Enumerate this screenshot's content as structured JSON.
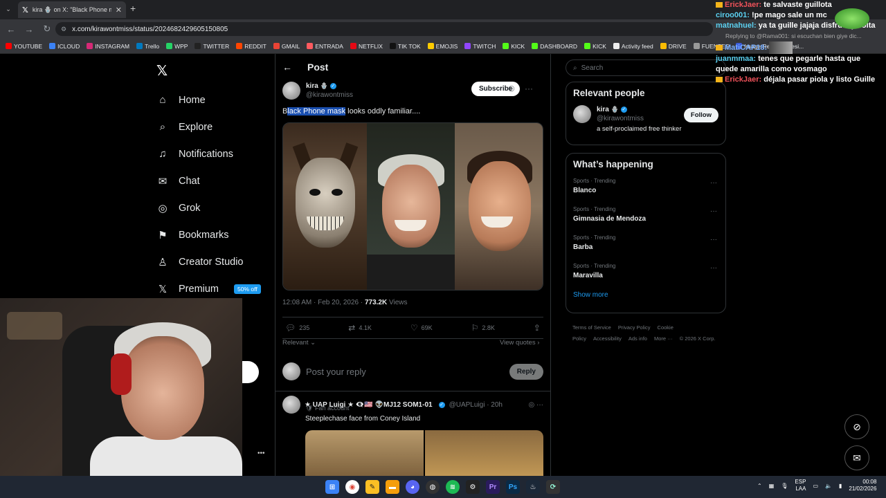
{
  "browser": {
    "tab_title": "kira 🪬 on X: \"Black Phone ma...",
    "url": "x.com/kirawontmiss/status/2024682429605150805",
    "bookmarks": [
      {
        "label": "YOUTUBE",
        "color": "#ff0000"
      },
      {
        "label": "ICLOUD",
        "color": "#3b82f6"
      },
      {
        "label": "INSTAGRAM",
        "color": "#d62976"
      },
      {
        "label": "Trello",
        "color": "#0079bf"
      },
      {
        "label": "WPP",
        "color": "#25d366"
      },
      {
        "label": "TWITTER",
        "color": "#222222"
      },
      {
        "label": "REDDIT",
        "color": "#ff4500"
      },
      {
        "label": "GMAIL",
        "color": "#ea4335"
      },
      {
        "label": "ENTRADA",
        "color": "#ff5a5f"
      },
      {
        "label": "NETFLIX",
        "color": "#e50914"
      },
      {
        "label": "TIK TOK",
        "color": "#111111"
      },
      {
        "label": "EMOJIS",
        "color": "#ffcc00"
      },
      {
        "label": "TWITCH",
        "color": "#9146ff"
      },
      {
        "label": "KICK",
        "color": "#53fc18"
      },
      {
        "label": "DASHBOARD",
        "color": "#53fc18"
      },
      {
        "label": "KICK",
        "color": "#53fc18"
      },
      {
        "label": "Activity feed",
        "color": "#eeeeee"
      },
      {
        "label": "DRIVE",
        "color": "#fbbc04"
      },
      {
        "label": "FUENTES",
        "color": "#999999"
      },
      {
        "label": "Image Resizer | Resi...",
        "color": "#3b5bdb"
      }
    ]
  },
  "nav": {
    "items": [
      {
        "label": "Home",
        "icon": "⌂"
      },
      {
        "label": "Explore",
        "icon": "⌕"
      },
      {
        "label": "Notifications",
        "icon": "♫"
      },
      {
        "label": "Chat",
        "icon": "✉"
      },
      {
        "label": "Grok",
        "icon": "◎"
      },
      {
        "label": "Bookmarks",
        "icon": "⚑"
      },
      {
        "label": "Creator Studio",
        "icon": "♙"
      },
      {
        "label": "Premium",
        "icon": "𝕏"
      }
    ],
    "premium_badge": "50% off"
  },
  "post": {
    "header": "Post",
    "author_name": "kira",
    "author_handle": "@kirawontmiss",
    "subscribe_label": "Subscribe",
    "text_highlight": "lack Phone mask",
    "text_pre": "B",
    "text_post": " looks oddly familiar....",
    "time": "12:08 AM · Feb 20, 2026 · ",
    "views_count": "773.2K",
    "views_label": " Views",
    "replies": "235",
    "reposts": "4.1K",
    "likes": "69K",
    "bookmarks": "2.8K",
    "relevant": "Relevant",
    "view_quotes": "View quotes",
    "reply_placeholder": "Post your reply",
    "reply_button": "Reply"
  },
  "reply_post": {
    "name": "★ UAP Luigi ★ 👁‍🗨🇺🇸 👽MJ12 SOM1-01",
    "handle": "@UAPLuigi · 20h",
    "badge": "Fan account",
    "text": "Steeplechase face from Coney Island"
  },
  "right": {
    "search_placeholder": "Search",
    "relevant_people_title": "Relevant people",
    "person_name": "kira",
    "person_handle": "@kirawontmiss",
    "person_bio": "a self-proclaimed free thinker",
    "follow_label": "Follow",
    "happening_title": "What’s happening",
    "trends": [
      {
        "category": "Sports · Trending",
        "topic": "Blanco"
      },
      {
        "category": "Sports · Trending",
        "topic": "Gimnasia de Mendoza"
      },
      {
        "category": "Sports · Trending",
        "topic": "Barba"
      },
      {
        "category": "Sports · Trending",
        "topic": "Maravilla"
      }
    ],
    "show_more": "Show more",
    "footer": [
      "Terms of Service",
      "Privacy Policy",
      "Cookie Policy",
      "Accessibility",
      "Ads info",
      "More ···",
      "© 2026 X Corp."
    ]
  },
  "chat": [
    {
      "user": "ErickJaer:",
      "msg": "te salvaste guillota",
      "color": "red",
      "crown": true
    },
    {
      "user": "ciroo001:",
      "msg": "!pe mago sale un mc",
      "color": "cyan",
      "crown": false
    },
    {
      "user": "matnahuel:",
      "msg": "ya ta guille jajaja disfruta y solta",
      "color": "cyan",
      "crown": false
    },
    {
      "reply_to": "Replying to @Rama001: si escuchan bien giye dic..."
    },
    {
      "user": "MatiCAP18:",
      "msg": "",
      "color": "blue",
      "crown": true,
      "emote": true
    },
    {
      "user": "juanmmaa:",
      "msg": "tenes que pegarle hasta que quede amarilla como vosmago",
      "color": "cyan",
      "crown": false
    },
    {
      "user": "ErickJaer:",
      "msg": "déjala pasar piola y listo Guille",
      "color": "red",
      "crown": true
    }
  ],
  "taskbar": {
    "lang": "ESP",
    "lang2": "LAA",
    "time": "00:08",
    "date": "21/02/2026"
  }
}
